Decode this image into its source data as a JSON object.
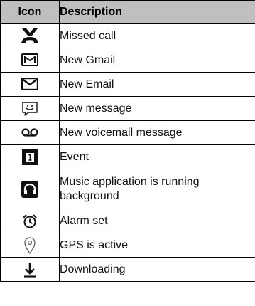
{
  "table": {
    "header": {
      "icon": "Icon",
      "description": "Description"
    },
    "rows": [
      {
        "icon": "missed-call-icon",
        "description": "Missed call"
      },
      {
        "icon": "gmail-icon",
        "description": "New Gmail"
      },
      {
        "icon": "email-icon",
        "description": "New Email"
      },
      {
        "icon": "message-icon",
        "description": "New message"
      },
      {
        "icon": "voicemail-icon",
        "description": "New voicemail message"
      },
      {
        "icon": "event-icon",
        "description": "Event"
      },
      {
        "icon": "headphones-icon",
        "description": "Music application is running background"
      },
      {
        "icon": "alarm-icon",
        "description": "Alarm set"
      },
      {
        "icon": "gps-icon",
        "description": "GPS is active"
      },
      {
        "icon": "download-icon",
        "description": "Downloading"
      }
    ]
  },
  "colors": {
    "header_bg": "#bfbfbf",
    "border": "#000000",
    "icon_fill": "#111111"
  }
}
